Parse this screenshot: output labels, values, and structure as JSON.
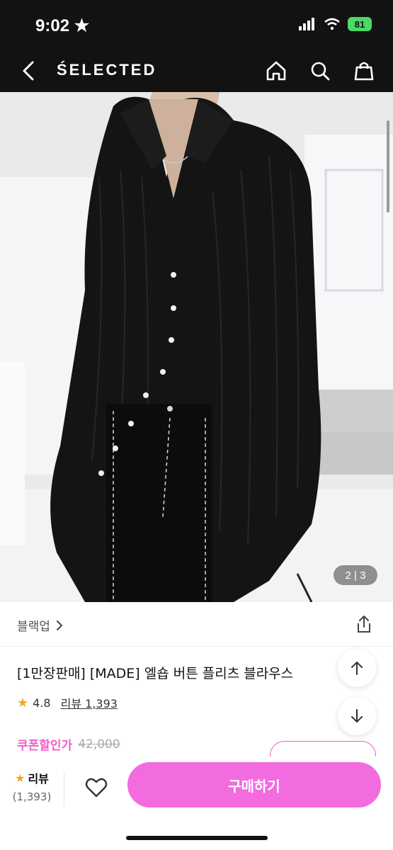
{
  "status_bar": {
    "time": "9:02",
    "battery": "81"
  },
  "nav": {
    "brand": "ŚELECTED"
  },
  "hero": {
    "counter": "2 | 3"
  },
  "product": {
    "category": "블랙업",
    "title": "[1만장판매] [MADE] 엘숍 버튼 플리츠 블라우스",
    "rating": "4.8",
    "review_link": "리뷰 1,393",
    "coupon_label": "쿠폰할인가",
    "original_price": "42,000"
  },
  "bottom_bar": {
    "review_label": "리뷰",
    "review_count": "(1,393)",
    "buy_label": "구매하기"
  },
  "colors": {
    "accent": "#f26ce0",
    "coupon": "#f25ec8",
    "star": "#f5a623"
  }
}
